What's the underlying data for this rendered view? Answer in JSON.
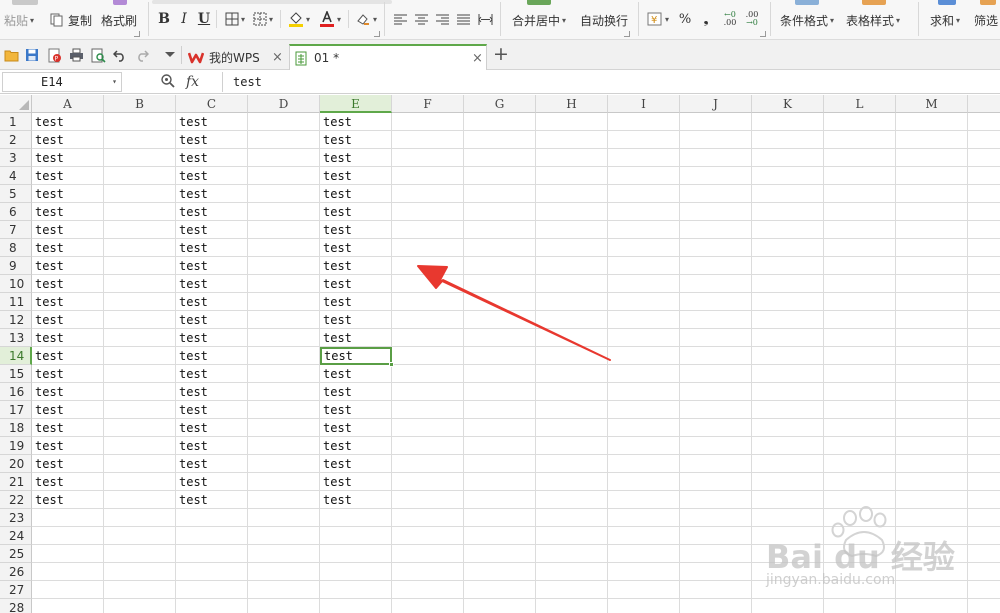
{
  "ribbon": {
    "paste_label": "粘贴",
    "copy_label": "复制",
    "format_painter_label": "格式刷",
    "bold": "B",
    "italic": "I",
    "underline": "U",
    "merge_center_label": "合并居中",
    "wrap_text_label": "自动换行",
    "percent": "%",
    "comma": "❟",
    "inc_decimal": ".00",
    "dec_decimal": ".00",
    "cond_format_label": "条件格式",
    "table_style_label": "表格样式",
    "sum_label": "求和",
    "filter_label": "筛选"
  },
  "tabs": {
    "home_tab": "我的WPS",
    "doc_tab": "01 *",
    "add": "+",
    "close": "×"
  },
  "formula_bar": {
    "cell_ref": "E14",
    "fx": "fx",
    "content": "test"
  },
  "sheet": {
    "columns": [
      "A",
      "B",
      "C",
      "D",
      "E",
      "F",
      "G",
      "H",
      "I",
      "J",
      "K",
      "L",
      "M"
    ],
    "rows": [
      "1",
      "2",
      "3",
      "4",
      "5",
      "6",
      "7",
      "8",
      "9",
      "10",
      "11",
      "12",
      "13",
      "14",
      "15",
      "16",
      "17",
      "18",
      "19",
      "20",
      "21",
      "22",
      "23",
      "24",
      "25",
      "26",
      "27",
      "28"
    ],
    "filled_columns": [
      "A",
      "C",
      "E"
    ],
    "filled_row_count": 22,
    "cell_text": "test",
    "active_cell": "E14",
    "selected_column": "E",
    "selected_row": "14"
  },
  "watermark": {
    "logo_text": "Bai du 经验",
    "url": "jingyan.baidu.com"
  },
  "colors": {
    "accent_green": "#5fa84a",
    "arrow_red": "#e8382f",
    "wps_red": "#d9322b"
  }
}
